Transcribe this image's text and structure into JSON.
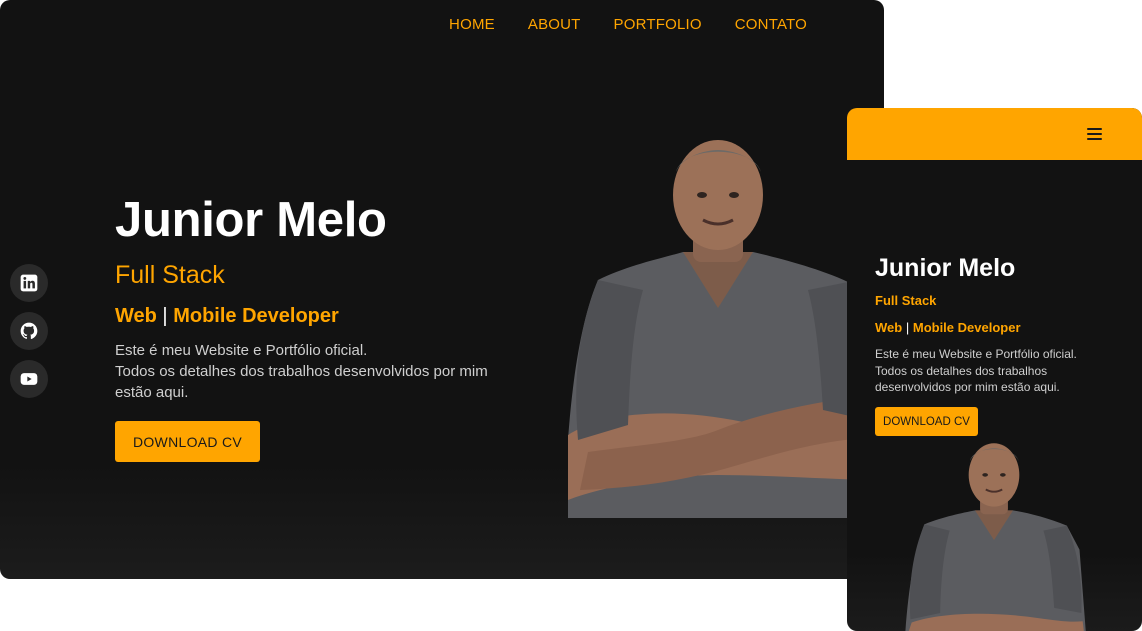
{
  "desktop": {
    "nav": [
      {
        "label": "HOME"
      },
      {
        "label": "ABOUT"
      },
      {
        "label": "PORTFOLIO"
      },
      {
        "label": "CONTATO"
      }
    ],
    "social": [
      {
        "icon": "linkedin-icon"
      },
      {
        "icon": "github-icon"
      },
      {
        "icon": "youtube-icon"
      }
    ],
    "hero": {
      "name": "Junior Melo",
      "stack": "Full Stack",
      "role_left": "Web",
      "role_sep": "|",
      "role_right": "Mobile Developer",
      "desc_line1": "Este é meu Website e Portfólio oficial.",
      "desc_line2": "Todos os detalhes dos trabalhos desenvolvidos por mim estão aqui.",
      "cta": "DOWNLOAD CV"
    }
  },
  "mobile": {
    "menu_icon": "hamburger-icon",
    "hero": {
      "name": "Junior Melo",
      "stack": "Full Stack",
      "role_left": "Web",
      "role_sep": "|",
      "role_right": "Mobile Developer",
      "desc_line1": "Este é meu Website e Portfólio oficial.",
      "desc_line2": "Todos os detalhes dos trabalhos desenvolvidos por mim estão aqui.",
      "cta": "DOWNLOAD CV"
    }
  },
  "colors": {
    "accent": "#ffa500",
    "background": "#121212",
    "text": "#ffffff",
    "muted": "#cfcfcf"
  }
}
